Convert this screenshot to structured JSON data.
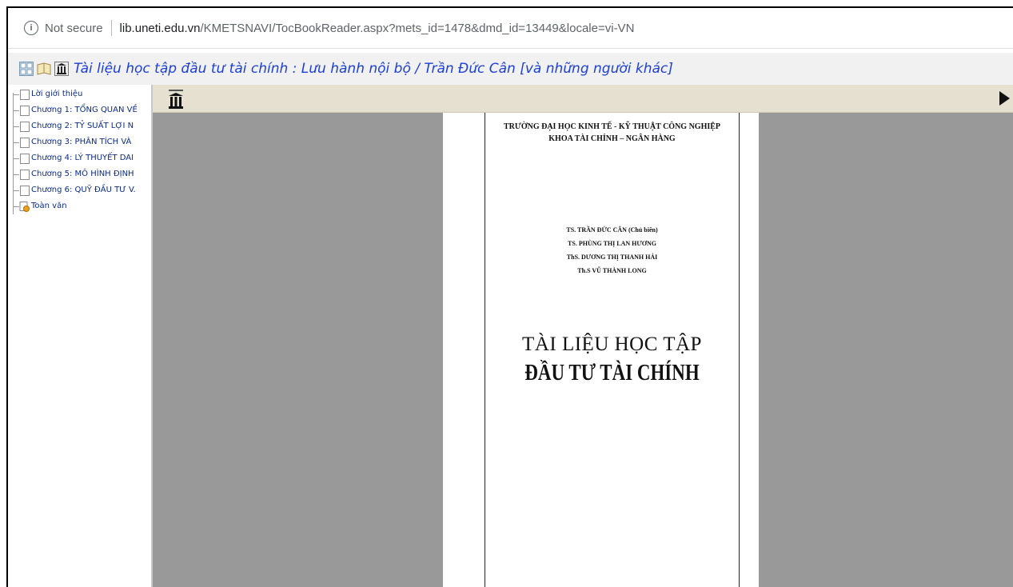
{
  "browser": {
    "security_label": "Not secure",
    "domain": "lib.uneti.edu.vn",
    "path": "/KMETSNAVI/TocBookReader.aspx?mets_id=1478&dmd_id=13449&locale=vi-VN"
  },
  "reader": {
    "title": "Tài liệu học tập đầu tư tài chính : Lưu hành nội bộ / Trần Đức Cân [và những người khác]"
  },
  "toc": {
    "items": [
      "Lời giới thiệu",
      "Chương 1: TỔNG QUAN VỀ",
      "Chương 2: TỶ SUẤT LỢI N",
      "Chương 3: PHÂN TÍCH VÀ",
      "Chương 4: LÝ THUYẾT DAI",
      "Chương 5: MÔ HÌNH ĐỊNH",
      "Chương 6: QUỸ ĐẦU TƯ V.",
      "Toàn văn"
    ]
  },
  "page": {
    "school": "TRƯỜNG ĐẠI HỌC KINH TẾ - KỸ THUẬT CÔNG NGHIỆP",
    "faculty": "KHOA TÀI CHÍNH – NGÂN HÀNG",
    "authors": [
      "TS. TRẦN ĐỨC CÂN (Chủ biên)",
      "TS. PHÙNG THỊ LAN HƯƠNG",
      "ThS. DƯƠNG THỊ THANH HẢI",
      "Th.S VŨ THÀNH LONG"
    ],
    "title_line1": "TÀI LIỆU HỌC TẬP",
    "title_line2": "ĐẦU TƯ TÀI CHÍNH"
  }
}
